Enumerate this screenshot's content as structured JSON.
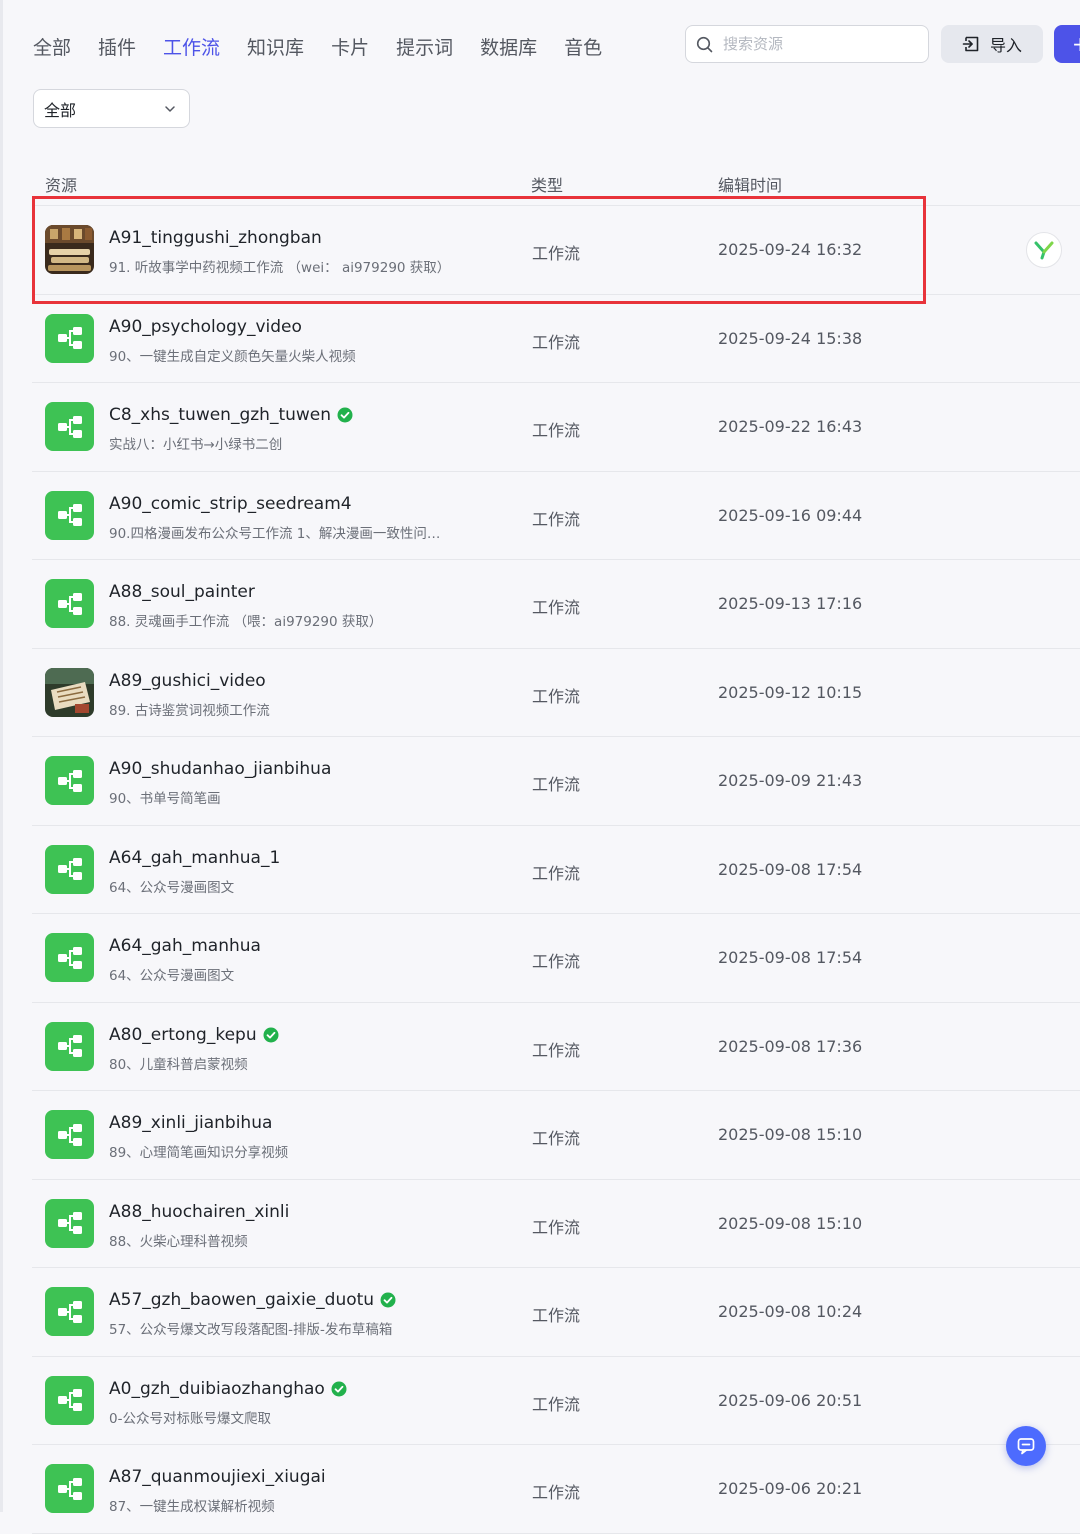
{
  "tabs": [
    {
      "label": "全部",
      "active": false
    },
    {
      "label": "插件",
      "active": false
    },
    {
      "label": "工作流",
      "active": true
    },
    {
      "label": "知识库",
      "active": false
    },
    {
      "label": "卡片",
      "active": false
    },
    {
      "label": "提示词",
      "active": false
    },
    {
      "label": "数据库",
      "active": false
    },
    {
      "label": "音色",
      "active": false
    }
  ],
  "search": {
    "placeholder": "搜索资源",
    "value": ""
  },
  "import_label": "导入",
  "create_label": "+",
  "filter": {
    "selected": "全部"
  },
  "table": {
    "headers": {
      "resource": "资源",
      "type": "类型",
      "edit_time": "编辑时间"
    },
    "rows": [
      {
        "title": "A91_tinggushi_zhongban",
        "desc": "91. 听故事学中药视频工作流 （wei： ai979290 获取）",
        "type": "工作流",
        "time": "2025-09-24 16:32",
        "icon": "image-thumbnail",
        "verified": false,
        "action": "agent-icon"
      },
      {
        "title": "A90_psychology_video",
        "desc": "90、一键生成自定义颜色矢量火柴人视频",
        "type": "工作流",
        "time": "2025-09-24 15:38",
        "icon": "workflow-icon",
        "verified": false
      },
      {
        "title": "C8_xhs_tuwen_gzh_tuwen",
        "desc": "实战八：小红书→小绿书二创",
        "type": "工作流",
        "time": "2025-09-22 16:43",
        "icon": "workflow-icon",
        "verified": true
      },
      {
        "title": "A90_comic_strip_seedream4",
        "desc": "90.四格漫画发布公众号工作流 1、解决漫画一致性问…",
        "type": "工作流",
        "time": "2025-09-16 09:44",
        "icon": "workflow-icon",
        "verified": false
      },
      {
        "title": "A88_soul_painter",
        "desc": "88. 灵魂画手工作流 （喂：ai979290 获取）",
        "type": "工作流",
        "time": "2025-09-13 17:16",
        "icon": "workflow-icon",
        "verified": false
      },
      {
        "title": "A89_gushici_video",
        "desc": "89. 古诗鉴赏词视频工作流",
        "type": "工作流",
        "time": "2025-09-12 10:15",
        "icon": "image-thumbnail",
        "verified": false
      },
      {
        "title": "A90_shudanhao_jianbihua",
        "desc": "90、书单号简笔画",
        "type": "工作流",
        "time": "2025-09-09 21:43",
        "icon": "workflow-icon",
        "verified": false
      },
      {
        "title": "A64_gah_manhua_1",
        "desc": "64、公众号漫画图文",
        "type": "工作流",
        "time": "2025-09-08 17:54",
        "icon": "workflow-icon",
        "verified": false
      },
      {
        "title": "A64_gah_manhua",
        "desc": "64、公众号漫画图文",
        "type": "工作流",
        "time": "2025-09-08 17:54",
        "icon": "workflow-icon",
        "verified": false
      },
      {
        "title": "A80_ertong_kepu",
        "desc": "80、儿童科普启蒙视频",
        "type": "工作流",
        "time": "2025-09-08 17:36",
        "icon": "workflow-icon",
        "verified": true
      },
      {
        "title": "A89_xinli_jianbihua",
        "desc": "89、心理简笔画知识分享视频",
        "type": "工作流",
        "time": "2025-09-08 15:10",
        "icon": "workflow-icon",
        "verified": false
      },
      {
        "title": "A88_huochairen_xinli",
        "desc": "88、火柴心理科普视频",
        "type": "工作流",
        "time": "2025-09-08 15:10",
        "icon": "workflow-icon",
        "verified": false
      },
      {
        "title": "A57_gzh_baowen_gaixie_duotu",
        "desc": "57、公众号爆文改写段落配图-排版-发布草稿箱",
        "type": "工作流",
        "time": "2025-09-08 10:24",
        "icon": "workflow-icon",
        "verified": true
      },
      {
        "title": "A0_gzh_duibiaozhanghao",
        "desc": "0-公众号对标账号爆文爬取",
        "type": "工作流",
        "time": "2025-09-06 20:51",
        "icon": "workflow-icon",
        "verified": true
      },
      {
        "title": "A87_quanmoujiexi_xiugai",
        "desc": "87、一键生成权谋解析视频",
        "type": "工作流",
        "time": "2025-09-06 20:21",
        "icon": "workflow-icon",
        "verified": false
      }
    ]
  },
  "colors": {
    "accent": "#4d53e8",
    "workflow_icon_bg": "#3ec254",
    "highlight_border": "#e8333a",
    "verified": "#22b14c"
  }
}
